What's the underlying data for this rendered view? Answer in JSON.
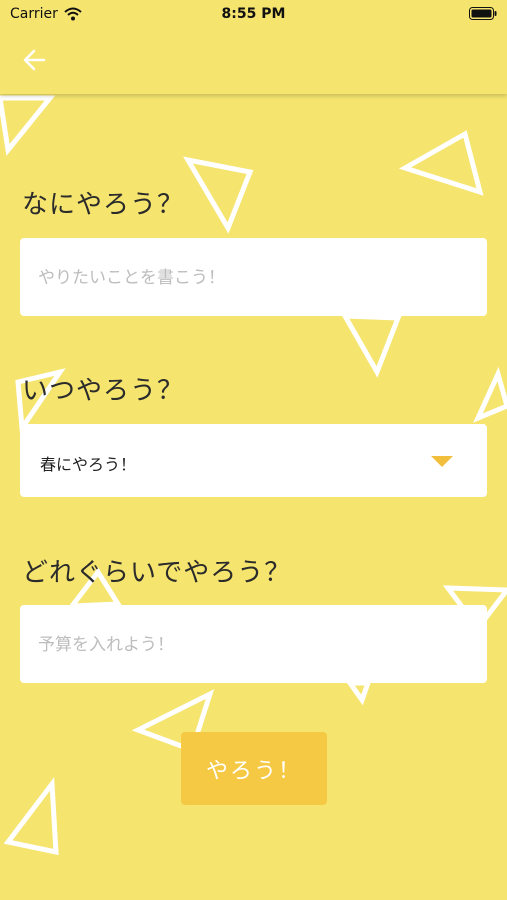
{
  "status_bar": {
    "carrier": "Carrier",
    "time": "8:55 PM"
  },
  "nav": {
    "back_icon": "arrow-left-icon"
  },
  "form": {
    "what_label": "なにやろう？",
    "what_placeholder": "やりたいことを書こう！",
    "when_label": "いつやろう？",
    "when_selected": "春にやろう！",
    "budget_label": "どれぐらいでやろう？",
    "budget_placeholder": "予算を入れよう！",
    "submit_label": "やろう！"
  },
  "colors": {
    "background": "#f5e46e",
    "accent": "#f6c944",
    "arrow": "#f1bf3c"
  }
}
